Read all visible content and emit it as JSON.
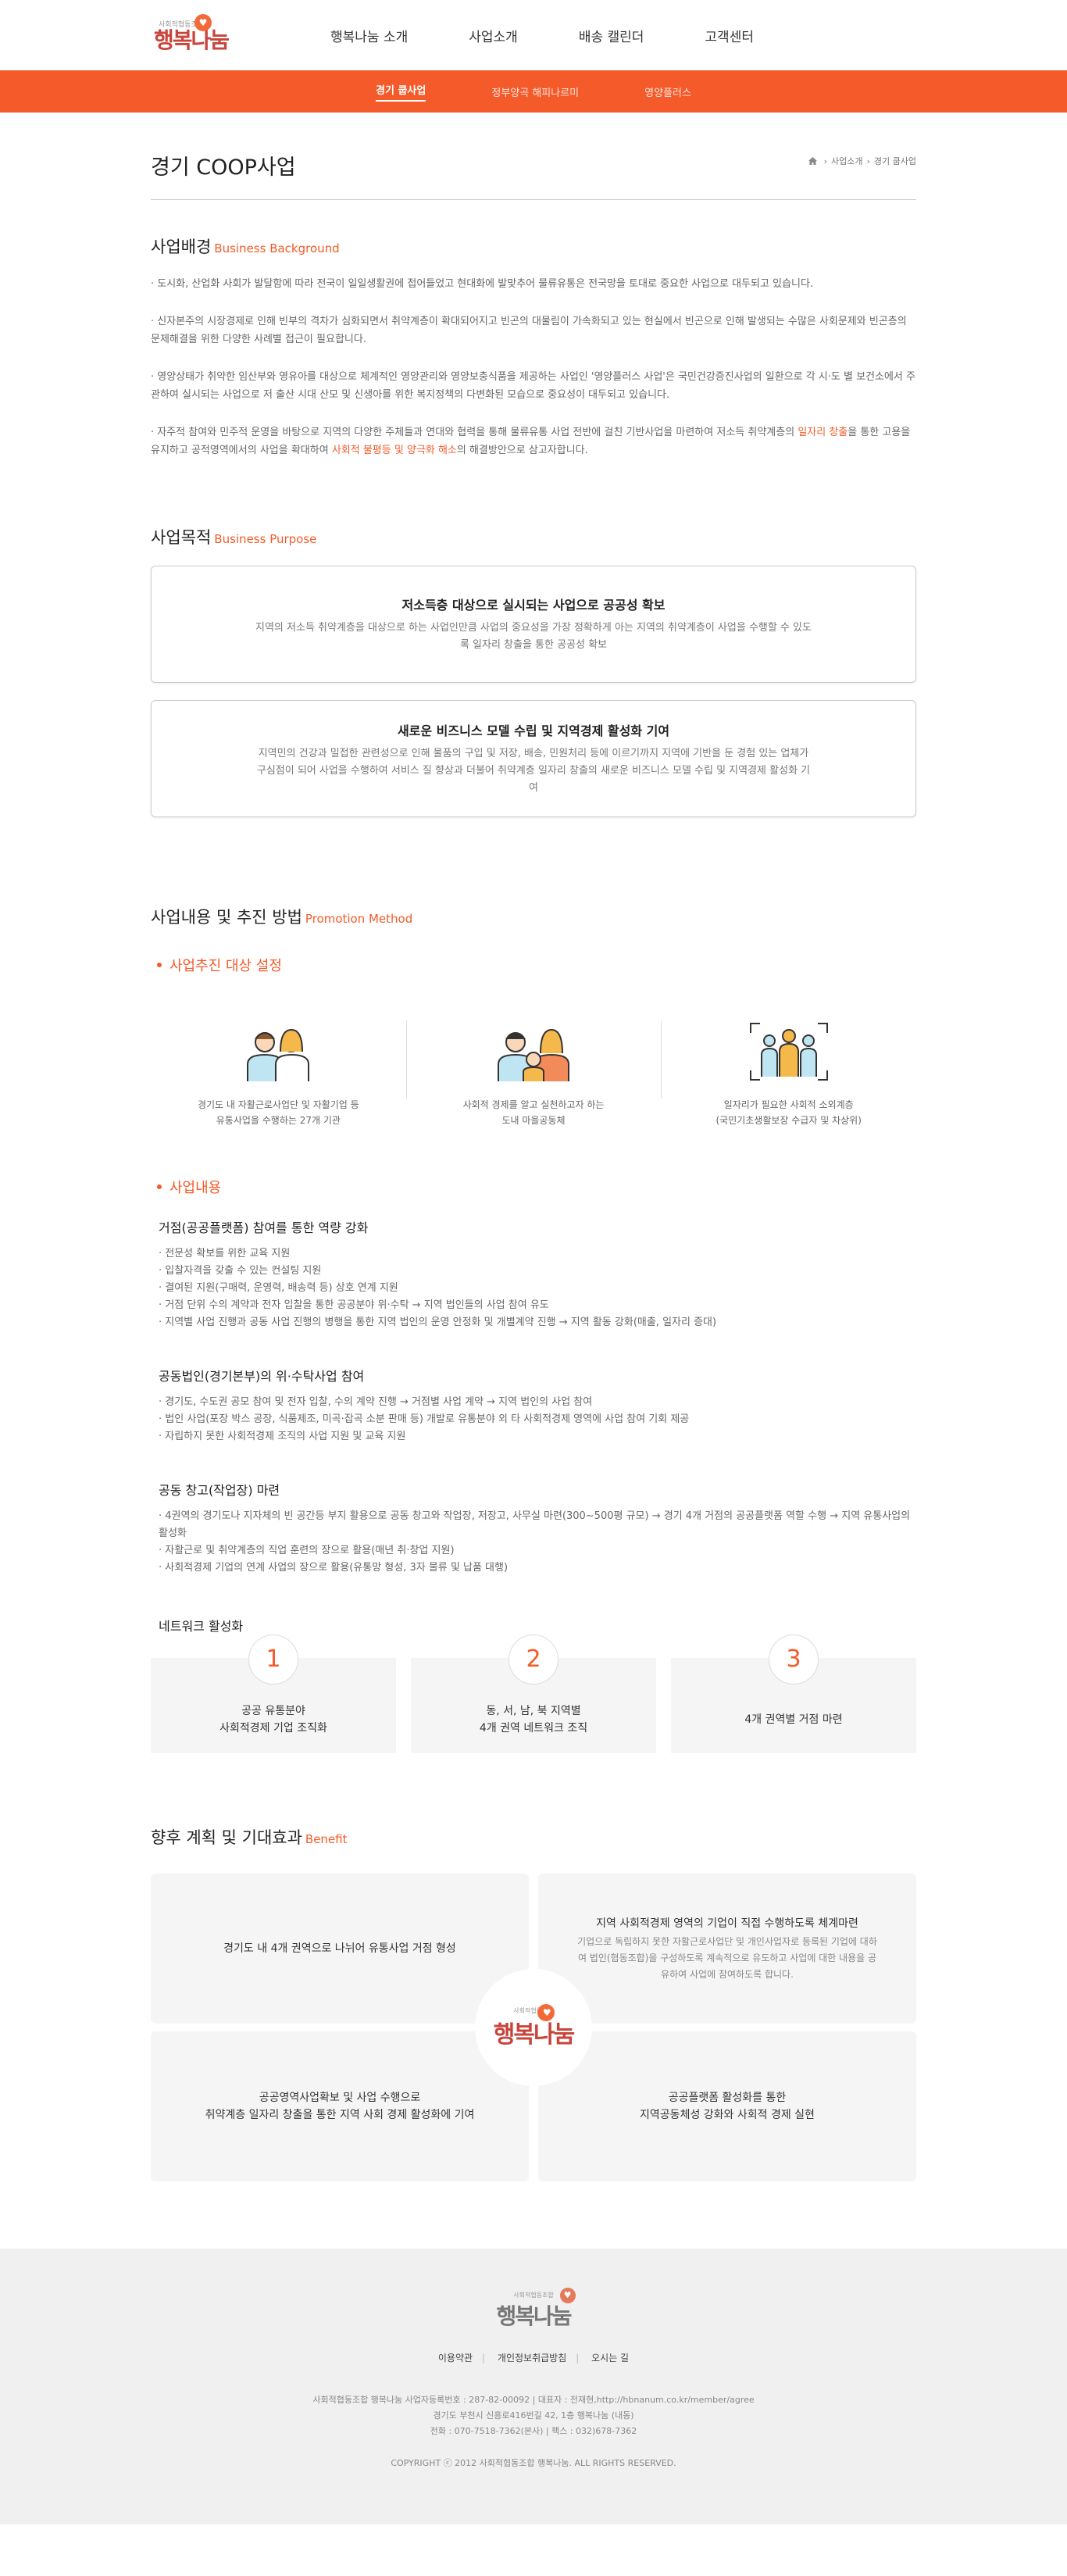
{
  "header": {
    "logo_tag": "사회적협동조합",
    "logo_name": "행복나눔",
    "nav": [
      "행복나눔 소개",
      "사업소개",
      "배송 캘린더",
      "고객센터"
    ]
  },
  "subnav": {
    "items": [
      "경기 쿱사업",
      "정부양곡 해피나르미",
      "영양플러스"
    ]
  },
  "page": {
    "title": "경기 COOP사업",
    "breadcrumb": [
      "사업소개",
      "경기 쿱사업"
    ]
  },
  "background": {
    "title": "사업배경",
    "title_en": "Business Background",
    "p1": "· 도시화, 산업화 사회가 발달함에 따라 전국이 일일생활권에 접어들었고 현대화에 발맞추어 물류유통은 전국망을 토대로 중요한 사업으로 대두되고 있습니다.",
    "p2": "· 신자본주의 시장경제로 인해 빈부의 격차가 심화되면서 취약계층이 확대되어지고 빈곤의 대물림이 가속화되고 있는 현실에서 빈곤으로 인해 발생되는 수많은 사회문제와 빈곤층의 문제해결을 위한 다양한 사례별 접근이 필요합니다.",
    "p3": "· 영양상태가 취약한 임산부와 영유아를 대상으로 체계적인 영양관리와 영양보충식품을 제공하는 사업인 '영양플러스 사업'은 국민건강증진사업의 일환으로 각 시·도 별 보건소에서 주관하여 실시되는 사업으로 저 출산 시대 산모 및 신생아를 위한 복지정책의 다변화된 모습으로 중요성이 대두되고 있습니다.",
    "p4a": "· 자주적 참여와 민주적 운영을 바탕으로 지역의 다양한 주체들과 연대와 협력을 통해 물류유통 사업 전반에 걸친 기반사업을 마련하여 저소득 취약계층의 ",
    "p4b": "일자리 창출",
    "p4c": "을 통한 고용을 유지하고 공적영역에서의 사업을 확대하여 ",
    "p4d": "사회적 불평등 및 양극화 해소",
    "p4e": "의 해결방안으로 삼고자합니다."
  },
  "purpose": {
    "title": "사업목적",
    "title_en": "Business Purpose",
    "box1_title": "저소득층 대상으로 실시되는 사업으로 공공성 확보",
    "box1_text": "지역의 저소득 취약계층을 대상으로 하는 사업인만큼 사업의 중요성을 가장 정확하게 아는 지역의 취약계층이 사업을 수행할 수 있도록 일자리 창출을 통한 공공성 확보",
    "box2_title": "새로운 비즈니스 모델 수립 및 지역경제 활성화 기여",
    "box2_text": "지역민의 건강과 밀접한 관련성으로 인해 물품의 구입 및 저장, 배송, 민원처리 등에 이르기까지 지역에 기반을 둔 경험 있는 업체가 구심점이 되어 사업을 수행하여 서비스 질 향상과 더불어 취약계층 일자리 창출의 새로운 비즈니스 모델 수립 및 지역경제 활성화 기여"
  },
  "method": {
    "title": "사업내용 및 추진 방법",
    "title_en": "Promotion Method",
    "target_label": "사업추진 대상 설정",
    "targets": [
      {
        "line1": "경기도 내 자활근로사업단 및 자활기업 등",
        "line2": "유통사업을 수행하는 27개 기관"
      },
      {
        "line1": "사회적 경제를 알고 실천하고자 하는",
        "line2": "도내 마을공동체"
      },
      {
        "line1": "일자리가 필요한 사회적 소외계층",
        "line2": "(국민기초생활보장 수급자 및 차상위)"
      }
    ],
    "content_label": "사업내용",
    "blocks": [
      {
        "title": "거점(공공플랫폼) 참여를 통한 역량 강화",
        "items": [
          "· 전문성 확보를 위한 교육 지원",
          "· 입찰자격을 갖출 수 있는 컨설팅 지원",
          "· 결여된 지원(구매력, 운영력, 배송력 등) 상호 연계 지원",
          "· 거점 단위 수의 계약과 전자 입찰을 통한 공공분야 위·수탁 → 지역 법인들의 사업 참여 유도",
          "· 지역별 사업 진행과 공동 사업 진행의 병행을 통한 지역 법인의 운영 안정화 및 개별계약 진행 → 지역 활동 강화(매출, 일자리 증대)"
        ]
      },
      {
        "title": "공동법인(경기본부)의 위·수탁사업 참여",
        "items": [
          "· 경기도, 수도권 공모 참여 및 전자 입찰, 수의 계약 진행 → 거점별 사업 계약 → 지역 법인의 사업 참여",
          "· 법인 사업(포장 박스 공장, 식품제조, 미곡·잡곡 소분 판매 등) 개발로 유통분야 외 타 사회적경제 영역에 사업 참여 기회 제공",
          "· 자립하지 못한 사회적경제 조직의 사업 지원 및 교육 지원"
        ]
      },
      {
        "title": "공동 창고(작업장) 마련",
        "items": [
          "· 4권역의 경기도나 지자체의 빈 공간등 부지 활용으로 공동 창고와 작업장, 저장고, 사무실 마련(300~500평 규모) → 경기 4개 거점의 공공플랫폼 역할 수행 → 지역 유통사업의 활성화",
          "· 자활근로 및 취약계층의 직업 훈련의 장으로 활용(매년 취·창업 지원)",
          "· 사회적경제 기업의 연계 사업의 장으로 활용(유통망 형성, 3자 물류 및 납품 대행)"
        ]
      }
    ],
    "network_title": "네트워크 활성화",
    "network": [
      {
        "num": "1",
        "line1": "공공 유통분야",
        "line2": "사회적경제 기업 조직화"
      },
      {
        "num": "2",
        "line1": "동, 서, 남, 북 지역별",
        "line2": "4개 권역 네트워크 조직"
      },
      {
        "num": "3",
        "line1": "4개 권역별 거점 마련",
        "line2": ""
      }
    ]
  },
  "benefit": {
    "title": "향후 계획 및 기대효과",
    "title_en": "Benefit",
    "cards": [
      {
        "title": "경기도 내 4개 권역으로 나뉘어 유통사업 거점 형성",
        "title2": "",
        "text": ""
      },
      {
        "title": "지역 사회적경제 영역의 기업이 직접 수행하도록 체계마련",
        "title2": "",
        "text": "기업으로 독립하지 못한 자활근로사업단 및 개인사업자로 등록된 기업에 대하여 법인(협동조합)을 구성하도록 계속적으로 유도하고 사업에 대한 내용을 공유하여 사업에 참여하도록 합니다."
      },
      {
        "title": "공공영역사업확보 및 사업 수행으로",
        "title2": "취약계층 일자리 창출을 통한 지역 사회 경제 활성화에 기여",
        "text": ""
      },
      {
        "title": "공공플랫폼 활성화를 통한",
        "title2": "지역공동체성 강화와 사회적 경제 실현",
        "text": ""
      }
    ]
  },
  "footer": {
    "links": [
      "이용약관",
      "개인정보취급방침",
      "오시는 길"
    ],
    "info1": "사회적협동조합 행복나눔 사업자등록번호 : 287-82-00092   |   대표자 : 전재현,http://hbnanum.co.kr/member/agree",
    "info2": "경기도 부천시 신흥로416번길 42, 1층 행복나눔 (내동)",
    "info3": "전화 : 070-7518-7362(본사)   |   팩스 : 032)678-7362",
    "copyright": "COPYRIGHT ⓒ 2012 사회적협동조합 행복나눔. ALL RIGHTS RESERVED."
  },
  "colors": {
    "accent": "#f45a2a",
    "logo": "#c9443b"
  }
}
